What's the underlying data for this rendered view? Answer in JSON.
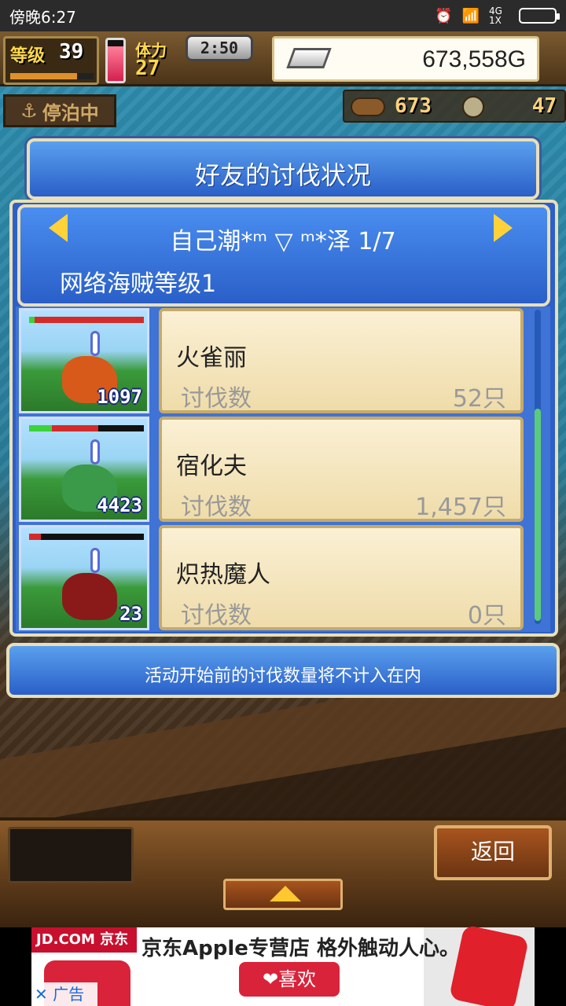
{
  "status_bar": {
    "time": "傍晚6:27",
    "network": "4G 1X"
  },
  "hud": {
    "level_label": "等级",
    "level_value": "39",
    "level_progress": 0.8,
    "stamina_fill": 0.85,
    "stamina_label": "体力",
    "stamina_value": "27",
    "timer": "2:50",
    "gold": "673,558G",
    "moor_status": "停泊中",
    "resource1": "673",
    "resource2": "47"
  },
  "dialog": {
    "title": "好友的讨伐状况",
    "friend_name": "自己潮*ᵐ ▽ ᵐ*泽 1/7",
    "friend_rank": "网络海贼等级1"
  },
  "monsters": [
    {
      "name": "火雀丽",
      "count_label": "讨伐数",
      "count": "52只",
      "level": "1097",
      "hp_green": 0.05,
      "hp_red": 0.95,
      "color": "#d85a1a"
    },
    {
      "name": "宿化夫",
      "count_label": "讨伐数",
      "count": "1,457只",
      "level": "4423",
      "hp_green": 0.2,
      "hp_red": 0.4,
      "color": "#3a9a4a"
    },
    {
      "name": "炽热魔人",
      "count_label": "讨伐数",
      "count": "0只",
      "level": "23",
      "hp_green": 0.0,
      "hp_red": 0.1,
      "color": "#8a1a1a"
    }
  ],
  "notice": "活动开始前的讨伐数量将不计入在内",
  "buttons": {
    "back": "返回"
  },
  "ad": {
    "logo": "JD.COM 京东",
    "headline": "京东Apple专营店  格外触动人心。",
    "like": "❤喜欢",
    "close": "✕ 广告"
  },
  "colors": {
    "panel_blue": "#2a5fc8",
    "panel_border": "#e9dfb8",
    "card_bg": "#faf0d4",
    "accent_yellow": "#ffd23a"
  }
}
